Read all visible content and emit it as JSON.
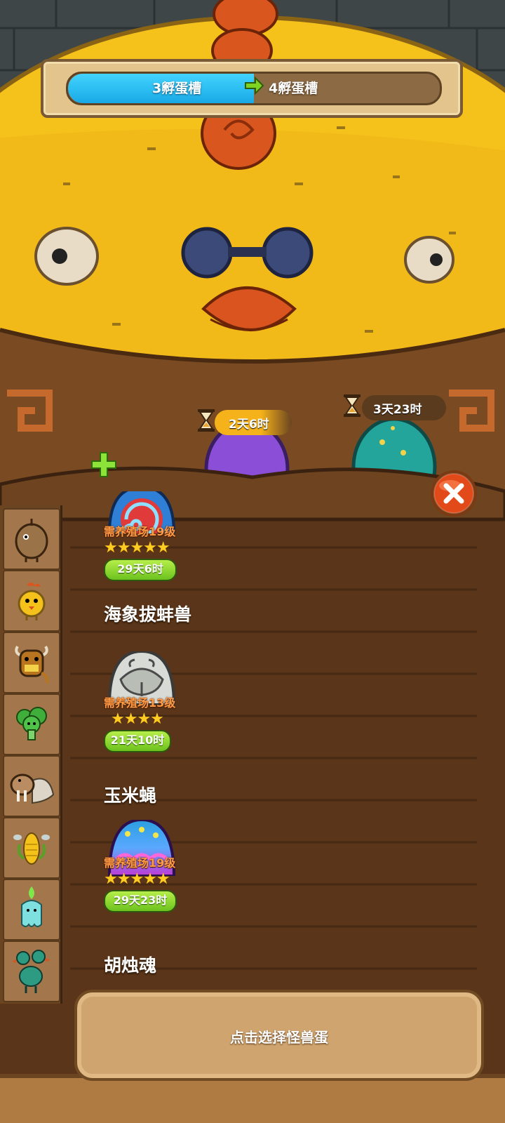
{
  "hatchery": {
    "current_slots": "3孵蛋槽",
    "next_slots": "4孵蛋槽",
    "upgrade_progress": 0.5
  },
  "incubating": [
    {
      "timer": "2天6时",
      "egg_color": "purple"
    },
    {
      "timer": "3天23时",
      "egg_color": "teal"
    }
  ],
  "add_slot_icon": "plus-icon",
  "close_icon": "close-icon",
  "sidebar": {
    "monsters": [
      "brown-bird",
      "chick",
      "yak",
      "broccoli",
      "walrus",
      "corn-fly",
      "ghost-candle",
      "two-headed-bird"
    ]
  },
  "eggs": [
    {
      "requirement": "需养殖场19级",
      "stars": "★★★★★",
      "time": "29天6时",
      "name": "海象拔蚌兽",
      "color": "red-spiral"
    },
    {
      "requirement": "需养殖场13级",
      "stars": "★★★★",
      "time": "21天10时",
      "name": "玉米蝇",
      "color": "grey-shell"
    },
    {
      "requirement": "需养殖场19级",
      "stars": "★★★★★",
      "time": "29天23时",
      "name": "胡烛魂",
      "color": "rainbow"
    }
  ],
  "bottom_panel": {
    "label": "点击选择怪兽蛋"
  },
  "colors": {
    "progress_fill": "#19a9e6",
    "time_pill": "#6cc21e",
    "close_button": "#e24a1a",
    "timer_pill": "#f5b21a"
  }
}
